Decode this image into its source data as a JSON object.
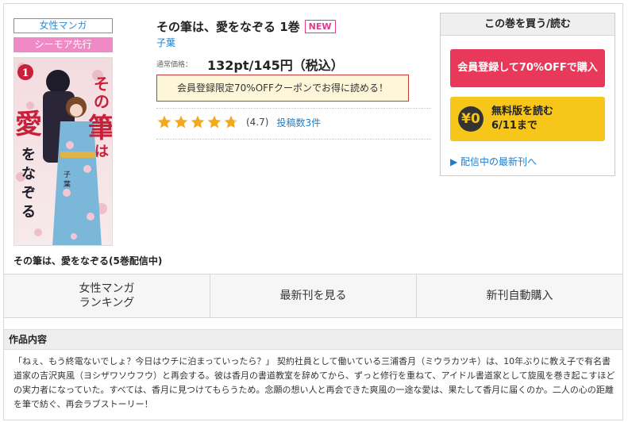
{
  "tags": {
    "genre": "女性マンガ",
    "label": "シーモア先行"
  },
  "cover": {
    "volume_badge": "1",
    "title_vertical": "その筆は、愛をなぞる",
    "author_vertical": "子葉"
  },
  "series_title": "その筆は、愛をなぞる(5巻配信中)",
  "book": {
    "title": "その筆は、愛をなぞる 1巻",
    "new_badge": "NEW",
    "author": "子葉",
    "price_label": "通常価格：",
    "price": "132pt/145円（税込）",
    "coupon": "会員登録限定70%OFFクーポンでお得に読める！"
  },
  "rating": {
    "value": 4.7,
    "value_text": "(4.7)",
    "review_link": "投稿数3件",
    "stars_filled": 4.7,
    "star_color": "#f4a81d"
  },
  "buy_panel": {
    "header": "この巻を買う/読む",
    "member_button": "会員登録して70%OFFで購入",
    "free_badge": "¥0",
    "free_line1": "無料版を読む",
    "free_line2": "6/11まで",
    "latest_link": "▶ 配信中の最新刊へ"
  },
  "nav": {
    "ranking_line1": "女性マンガ",
    "ranking_line2": "ランキング",
    "latest": "最新刊を見る",
    "auto_buy": "新刊自動購入"
  },
  "synopsis": {
    "heading": "作品内容",
    "text": "「ねぇ、もう終電ないでしょ？今日はウチに泊まっていったら？」 契約社員として働いている三浦香月（ミウラカツキ）は、10年ぶりに教え子で有名書道家の吉沢爽風（ヨシザワソウフウ）と再会する。彼は香月の書道教室を辞めてから、ずっと修行を重ねて、アイドル書道家として旋風を巻き起こすほどの実力者になっていた。すべては、香月に見つけてもらうため。念願の想い人と再会できた爽風の一途な愛は、果たして香月に届くのか。二人の心の距離を筆で紡ぐ、再会ラブストーリー！"
  },
  "colors": {
    "accent_pink": "#e9395a",
    "accent_yellow": "#f6c61b",
    "link_blue": "#1a7fd0"
  }
}
